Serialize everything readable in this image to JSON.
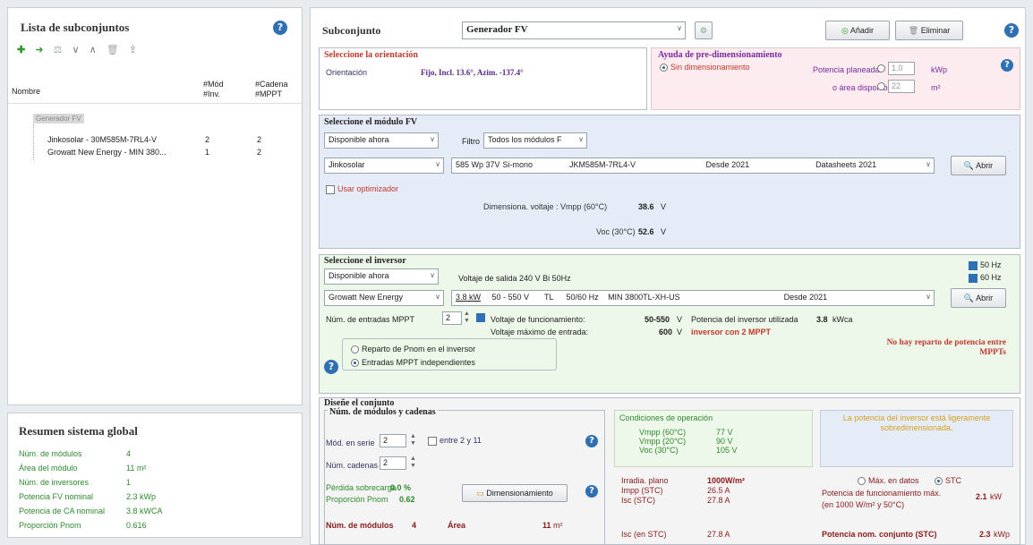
{
  "left": {
    "title": "Lista de subconjuntos",
    "toolbar_icons": [
      "add-icon",
      "arrow-right-icon",
      "scale-icon",
      "chevron-down-icon",
      "chevron-up-icon",
      "delete-icon",
      "export-icon"
    ],
    "headers": {
      "name": "Nombre",
      "mod": "#Mód #Inv.",
      "cad": "#Cadena #MPPT"
    },
    "group": "Generador FV",
    "rows": [
      {
        "name": "Jinkosolar - 30M585M-7RL4-V",
        "mod": "2",
        "cad": "2"
      },
      {
        "name": "Growatt New Energy - MIN 380...",
        "mod": "1",
        "cad": "2"
      }
    ]
  },
  "summary": {
    "title": "Resumen sistema global",
    "rows": [
      {
        "label": "Núm. de módulos",
        "value": "4"
      },
      {
        "label": "Área del módulo",
        "value": "11 m²"
      },
      {
        "label": "Núm. de inversores",
        "value": "1"
      },
      {
        "label": "Potencia FV nominal",
        "value": "2.3 kWp"
      },
      {
        "label": "Potencia de CA nominal",
        "value": "3.8 kWCA"
      },
      {
        "label": "Proporción Pnom",
        "value": "0.616"
      }
    ]
  },
  "header": {
    "label": "Subconjunto",
    "selected": "Generador FV",
    "add": "Añadir",
    "delete": "Eliminar"
  },
  "orientation": {
    "title": "Seleccione la orientación",
    "label": "Orientación",
    "value": "Fijo, Incl. 13.6°, Azim. -137.4°"
  },
  "predim": {
    "title": "Ayuda de pre-dimensionamiento",
    "option": "Sin dimensionamiento",
    "power_label": "Potencia planeada",
    "power_value": "1.0",
    "power_unit": "kWp",
    "area_label": "o área disponible",
    "area_value": "22",
    "area_unit": "m²"
  },
  "module": {
    "title": "Seleccione el módulo FV",
    "availability": "Disponible ahora",
    "filter_label": "Filtro",
    "filter_value": "Todos los módulos F",
    "manufacturer": "Jinkosolar",
    "model_power": "585 Wp 37V",
    "model_tech": "Si-mono",
    "model_name": "JKM585M-7RL4-V",
    "model_since": "Desde 2021",
    "model_source": "Datasheets 2021",
    "open": "Abrir",
    "optimizer": "Usar optimizador",
    "vmpp_label": "Dimensiona. voltaje : Vmpp (60°C)",
    "vmpp_value": "38.6",
    "voc_label": "Voc (30°C)",
    "voc_value": "52.6",
    "volt_unit": "V"
  },
  "inverter": {
    "title": "Seleccione el inversor",
    "availability": "Disponible ahora",
    "output_voltage": "Voltaje de salida 240 V Bi 50Hz",
    "hz50": "50 Hz",
    "hz60": "60 Hz",
    "manufacturer": "Growatt New Energy",
    "model_power": "3.8 kW",
    "model_range": "50 - 550 V",
    "model_tl": "TL",
    "model_freq": "50/60 Hz",
    "model_name": "MIN 3800TL-XH-US",
    "model_since": "Desde 2021",
    "open": "Abrir",
    "mppt_label": "Núm. de entradas MPPT",
    "mppt_value": "2",
    "op_volt_label": "Voltaje de funcionamiento:",
    "op_volt_value": "50-550",
    "max_volt_label": "Voltaje máximo de entrada:",
    "max_volt_value": "600",
    "volt_unit": "V",
    "used_power_label": "Potencia del inversor utilizada",
    "used_power_value": "3.8",
    "used_power_unit": "kWca",
    "mppt_note": "inversor con 2 MPPT",
    "opt_share": "Reparto de Pnom en el inversor",
    "opt_indep": "Entradas MPPT independientes",
    "warning": "No hay reparto de potencia entre MPPTs"
  },
  "design": {
    "title": "Diseñe el conjunto",
    "sub_title": "Núm. de módulos y cadenas",
    "series_label": "Mód. en serie",
    "series_value": "2",
    "series_range": "entre 2 y 11",
    "strings_label": "Núm. cadenas",
    "strings_value": "2",
    "overload_label": "Pérdida sobrecarga",
    "overload_value": "0.0 %",
    "ratio_label": "Proporción Pnom",
    "ratio_value": "0.62",
    "dim_button": "Dimensionamiento",
    "modules_label": "Núm. de módulos",
    "modules_value": "4",
    "area_label": "Área",
    "area_value": "11",
    "area_unit": "m²",
    "op_title": "Condiciones de operación",
    "op_rows": [
      {
        "label": "Vmpp (60°C)",
        "value": "77 V"
      },
      {
        "label": "Vmpp (20°C)",
        "value": "90 V"
      },
      {
        "label": "Voc (30°C)",
        "value": "105 V"
      }
    ],
    "irr_rows": [
      {
        "label": "Irradia. plano",
        "value": "1000W/m²"
      },
      {
        "label": "Impp (STC)",
        "value": "26.5 A"
      },
      {
        "label": "Isc (STC)",
        "value": "27.8 A"
      },
      {
        "label": "Isc (en STC)",
        "value": "27.8 A"
      }
    ],
    "undersized": "La potencia del inversor está ligeramente sobredimensionada.",
    "max_data": "Máx. en datos",
    "stc": "STC",
    "op_power_label": "Potencia de funcionamiento máx.",
    "op_power_value": "2.1",
    "op_power_unit": "kW",
    "op_power_cond": "(en 1000 W/m² y 50°C)",
    "nom_power_label": "Potencia nom. conjunto (STC)",
    "nom_power_value": "2.3",
    "nom_power_unit": "kWp"
  },
  "colors": {
    "accent": "#2f6fb3",
    "title_red": "#c0392b",
    "module_bg": "#e6ecf7",
    "inverter_bg": "#eef8ea",
    "design_bg": "#f4f4f4",
    "predim_bg": "#fdecef"
  }
}
